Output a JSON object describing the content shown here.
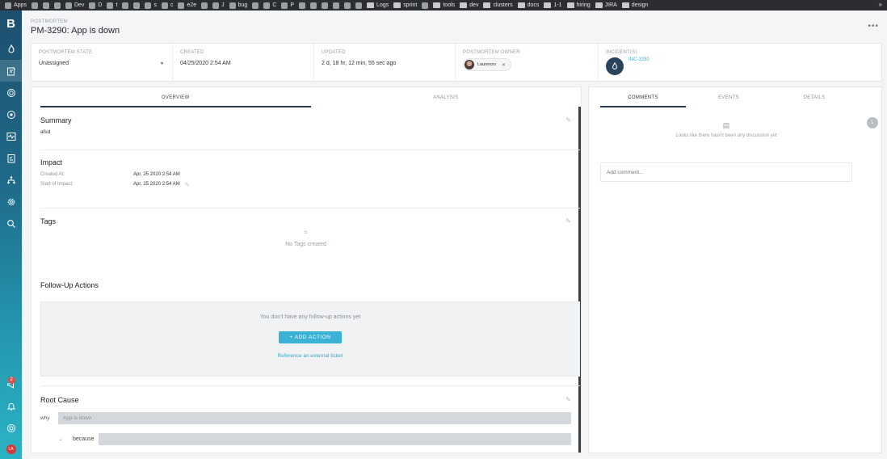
{
  "bookmarks": {
    "items": [
      {
        "label": "Apps",
        "icon": "apps-grid-icon"
      },
      {
        "label": "",
        "icon": "gmail-icon"
      },
      {
        "label": "",
        "icon": "bookmark-icon"
      },
      {
        "label": "",
        "icon": "chrome-icon"
      },
      {
        "label": "Dev",
        "icon": "bookmark-icon"
      },
      {
        "label": "D",
        "icon": "bookmark-icon"
      },
      {
        "label": "t",
        "icon": "bookmark-icon"
      },
      {
        "label": "",
        "icon": "bookmark-icon"
      },
      {
        "label": "",
        "icon": "github-icon"
      },
      {
        "label": "s",
        "icon": "github-icon"
      },
      {
        "label": "c",
        "icon": "github-icon"
      },
      {
        "label": "e2e",
        "icon": "github-icon"
      },
      {
        "label": "",
        "icon": "bookmark-icon"
      },
      {
        "label": "J",
        "icon": "bookmark-icon"
      },
      {
        "label": "bug",
        "icon": "bookmark-icon"
      },
      {
        "label": "",
        "icon": "bookmark-icon"
      },
      {
        "label": "C",
        "icon": "bookmark-icon"
      },
      {
        "label": "P",
        "icon": "bookmark-icon"
      },
      {
        "label": "",
        "icon": "bookmark-icon"
      },
      {
        "label": "",
        "icon": "linkedin-icon"
      },
      {
        "label": "",
        "icon": "bookmark-icon"
      },
      {
        "label": "",
        "icon": "bookmark-icon"
      },
      {
        "label": "",
        "icon": "bookmark-icon"
      },
      {
        "label": "",
        "icon": "bookmark-icon"
      },
      {
        "label": "Logs",
        "icon": "folder-icon"
      },
      {
        "label": "sprint",
        "icon": "folder-icon"
      },
      {
        "label": "",
        "icon": "bookmark-icon"
      },
      {
        "label": "tools",
        "icon": "folder-icon"
      },
      {
        "label": "dev",
        "icon": "folder-icon"
      },
      {
        "label": "clusters",
        "icon": "folder-icon"
      },
      {
        "label": "docs",
        "icon": "folder-icon"
      },
      {
        "label": "1-1",
        "icon": "folder-icon"
      },
      {
        "label": "hiring",
        "icon": "folder-icon"
      },
      {
        "label": "JIRA",
        "icon": "folder-icon"
      },
      {
        "label": "design",
        "icon": "folder-icon"
      }
    ],
    "more": "»"
  },
  "sidebar": {
    "logo": "B",
    "notification_count": "2",
    "user_initials": "LA"
  },
  "header": {
    "breadcrumb": "POSTMORTEM",
    "title": "PM-3290: App is down",
    "more": "•••"
  },
  "info": {
    "state_label": "POSTMORTEM STATE",
    "state_value": "Unassigned",
    "created_label": "CREATED",
    "created_value": "04/25/2020 2:54 AM",
    "updated_label": "UPDATED",
    "updated_value": "2 d, 18 hr, 12 min, 55 sec ago",
    "owner_label": "POSTMORTEM OWNER",
    "owner_name": "Laurenzo",
    "incidents_label": "INCIDENT(S)",
    "incident_id": "INC-3290"
  },
  "main": {
    "tabs": [
      {
        "label": "OVERVIEW",
        "active": true
      },
      {
        "label": "ANALYSIS",
        "active": false
      }
    ],
    "summary": {
      "title": "Summary",
      "text": "afsd"
    },
    "impact": {
      "title": "Impact",
      "rows": [
        {
          "key": "Created At:",
          "value": "Apr, 25 2020 2:54 AM"
        },
        {
          "key": "Start of Impact:",
          "value": "Apr, 25 2020 2:54 AM"
        }
      ]
    },
    "tags": {
      "title": "Tags",
      "empty": "No Tags created"
    },
    "followup": {
      "title": "Follow-Up Actions",
      "empty": "You don't have any follow-up actions yet",
      "add_button": "+ ADD ACTION",
      "external_link": "Reference an external ticket"
    },
    "root_cause": {
      "title": "Root Cause",
      "why_label": "why",
      "why_value": "App is down",
      "because_label": "because",
      "because_arrow": "→"
    }
  },
  "right": {
    "tabs": [
      {
        "label": "COMMENTS",
        "active": true
      },
      {
        "label": "EVENTS",
        "active": false
      },
      {
        "label": "DETAILS",
        "active": false
      }
    ],
    "empty_text": "Looks like there hasn't been any discussion yet",
    "comment_placeholder": "Add comment...",
    "user_initial": "L"
  },
  "colors": {
    "accent": "#39b2d6",
    "sidebar_top": "#1d4f6e",
    "sidebar_bottom": "#2bb3c4",
    "active_tab": "#2b3a4a"
  }
}
